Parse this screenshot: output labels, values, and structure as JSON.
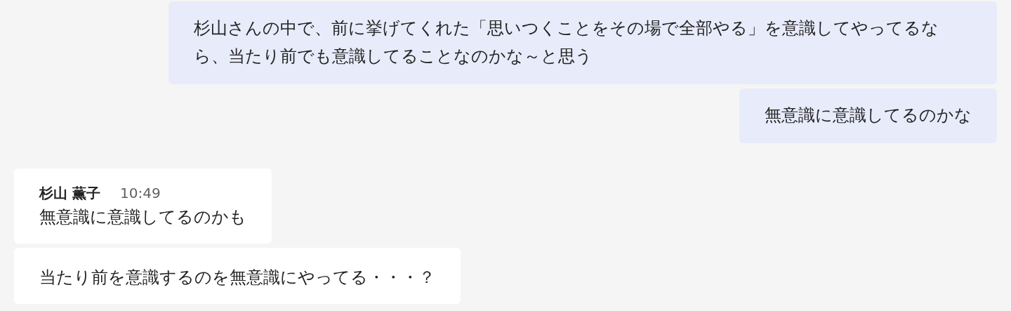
{
  "messages": [
    {
      "kind": "outgoing",
      "text": "杉山さんの中で、前に挙げてくれた「思いつくことをその場で全部やる」を意識してやってるなら、当たり前でも意識してることなのかな～と思う"
    },
    {
      "kind": "outgoing",
      "text": "無意識に意識してるのかな"
    },
    {
      "kind": "incoming",
      "author": "杉山 薫子",
      "time": "10:49",
      "text": "無意識に意識してるのかも"
    },
    {
      "kind": "incoming",
      "text": "当たり前を意識するのを無意識にやってる・・・？"
    }
  ]
}
